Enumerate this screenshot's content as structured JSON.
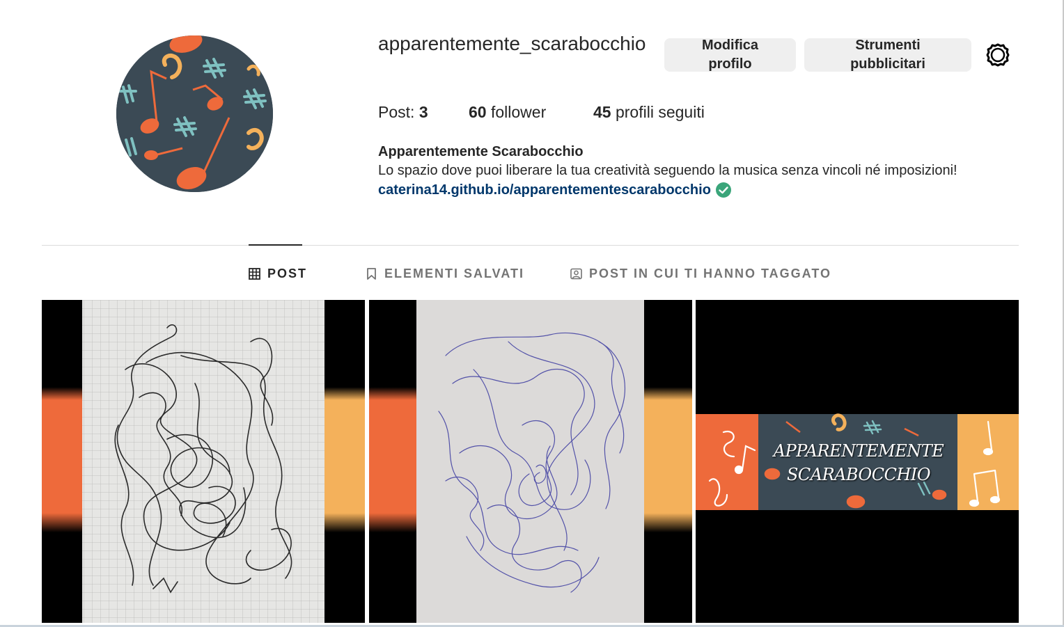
{
  "profile": {
    "username": "apparentemente_scarabocchio",
    "edit_button": "Modifica profilo",
    "ads_button": "Strumenti pubblicitari",
    "settings_icon": "gear-icon"
  },
  "stats": {
    "posts_label": "Post: ",
    "posts_count": "3",
    "followers_count": "60",
    "followers_label": " follower",
    "following_count": "45",
    "following_label": " profili seguiti"
  },
  "bio": {
    "name": "Apparentemente Scarabocchio",
    "text": "Lo spazio dove puoi liberare la tua creatività seguendo la musica senza vincoli né imposizioni!",
    "link": "caterina14.github.io/apparentementescarabocchio",
    "link_badge_icon": "verified-check-icon"
  },
  "tabs": [
    {
      "label": "POST",
      "icon": "grid-icon",
      "active": true
    },
    {
      "label": "ELEMENTI SALVATI",
      "icon": "bookmark-icon",
      "active": false
    },
    {
      "label": "POST IN CUI TI HANNO TAGGATO",
      "icon": "tagged-person-icon",
      "active": false
    }
  ],
  "posts": [
    {
      "kind": "scribble on grid paper"
    },
    {
      "kind": "scribble in blue pen"
    },
    {
      "banner_line1": "APPARENTEMENTE",
      "banner_line2": "SCARABOCCHIO"
    }
  ],
  "colors": {
    "avatar_bg": "#3b4a55",
    "orange": "#ee6a3b",
    "light_orange": "#f4b15b",
    "teal": "#7fc1c1",
    "link": "#00376b",
    "verified": "#3aa57a",
    "button_bg": "#efefef"
  }
}
